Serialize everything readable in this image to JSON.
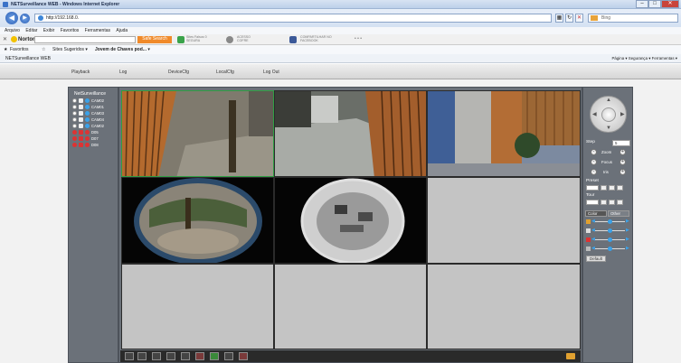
{
  "browser": {
    "title": "NETSurveillance WEB - Windows Internet Explorer",
    "url": "http://192.168.0.",
    "search_placeholder": "Bing",
    "menu": [
      "Arquivo",
      "Editar",
      "Exibir",
      "Favoritos",
      "Ferramentas",
      "Ajuda"
    ],
    "norton": {
      "logo": "Norton",
      "safe_search": "Safe Search",
      "item1_line1": "Sites Falsos 0",
      "item1_line2": "SEGURA",
      "item2_line1": "ACESSO",
      "item2_line2": "COFRE",
      "item3_line1": "COMPARTILHAR NO",
      "item3_line2": "FACEBOOK"
    },
    "favorites": {
      "label": "Favoritos",
      "item1": "Sites Sugeridos ▾",
      "item2": "Jovem de Chaves pod... ▾"
    },
    "tab_title": "NETSurveillance WEB",
    "tools": "Página ▾  Segurança ▾  Ferramentas ▾"
  },
  "app_nav": [
    "Playback",
    "Log",
    "DeviceCfg",
    "LocalCfg",
    "Log Out"
  ],
  "device_tree": {
    "root": "NetSurveillance",
    "channels": [
      {
        "label": "CAM02",
        "state": "normal"
      },
      {
        "label": "CAM01",
        "state": "normal"
      },
      {
        "label": "CAM03",
        "state": "normal"
      },
      {
        "label": "CAM04",
        "state": "normal"
      },
      {
        "label": "CAM02",
        "state": "normal"
      },
      {
        "label": "D05",
        "state": "alarm"
      },
      {
        "label": "D07",
        "state": "alarm"
      },
      {
        "label": "D08",
        "state": "alarm"
      }
    ]
  },
  "ptz": {
    "step_label": "Step",
    "step_value": "5",
    "zoom": "Zoom",
    "focus": "Focus",
    "iris": "Iris",
    "preset": "Preset",
    "tour": "Tour",
    "tab_color": "Color",
    "tab_other": "Other",
    "default_button": "Default"
  },
  "colors": {
    "panel": "#6b7179",
    "accent_blue": "#3aa1e8",
    "alarm_red": "#dd3333",
    "norton_orange": "#f08a2a"
  }
}
